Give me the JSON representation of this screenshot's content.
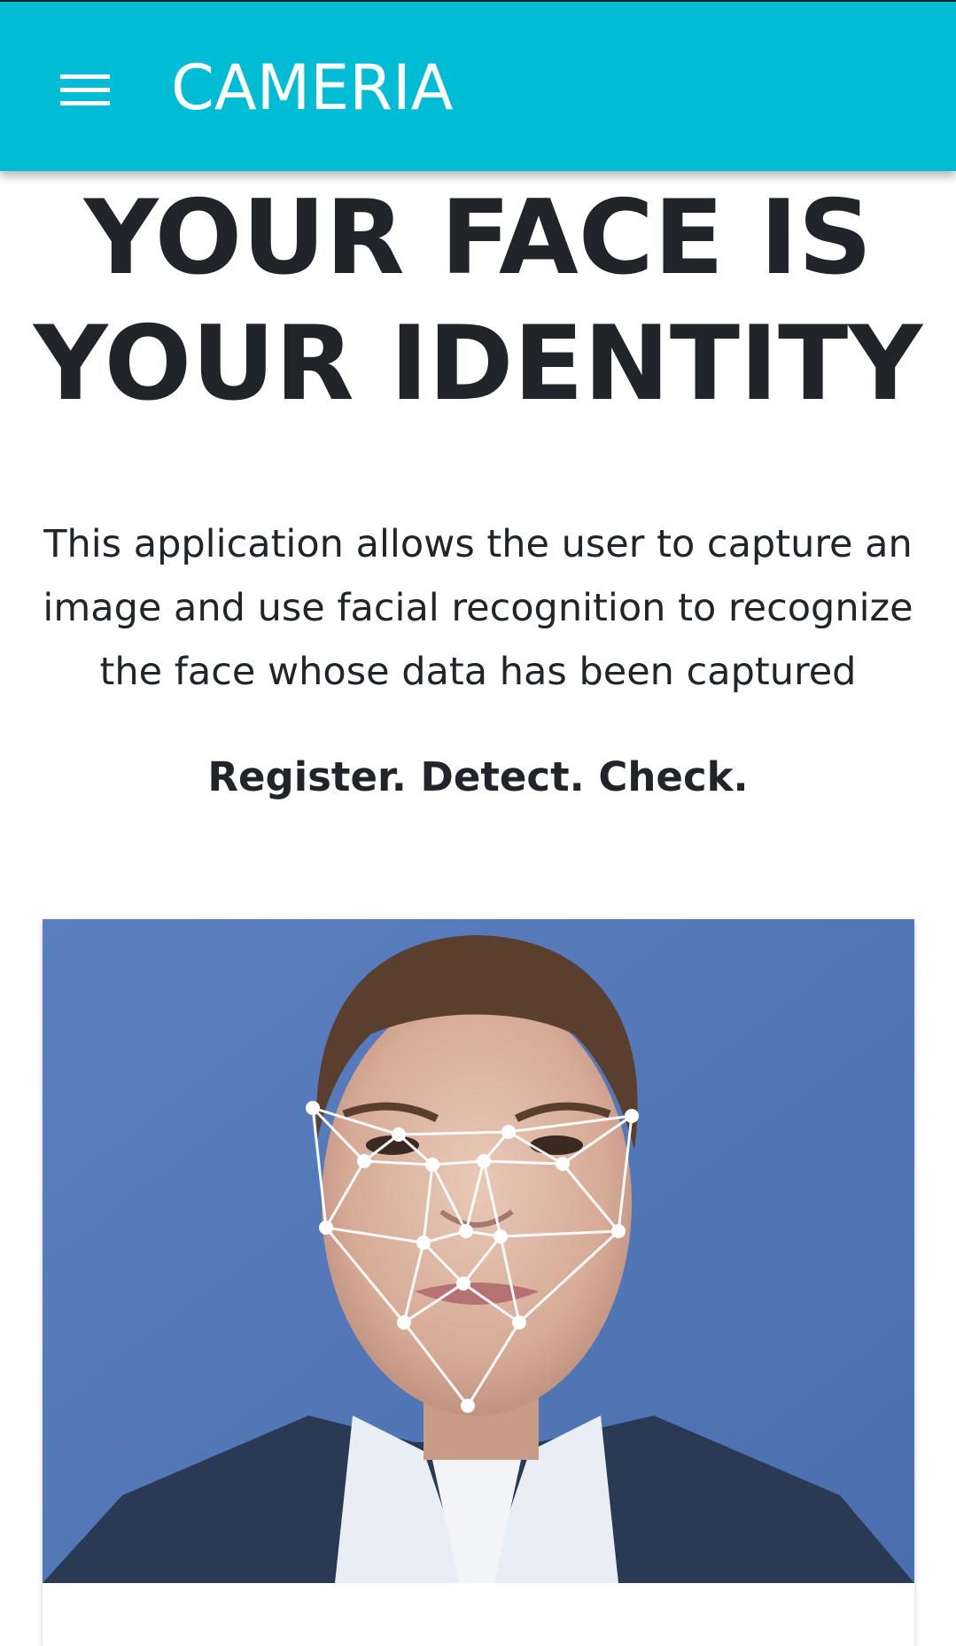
{
  "app_bar": {
    "title": "CAMERIA",
    "menu_icon": "hamburger-menu-icon",
    "background_color": "#00bcd4"
  },
  "hero": {
    "title_line1": "YOUR FACE IS",
    "title_line2": "YOUR IDENTITY"
  },
  "description": "This application allows the user to capture an image and use facial recognition to recognize the face whose data has been captured",
  "tagline": "Register. Detect. Check.",
  "card": {
    "image_alt": "Face with facial recognition landmark mesh overlay"
  }
}
